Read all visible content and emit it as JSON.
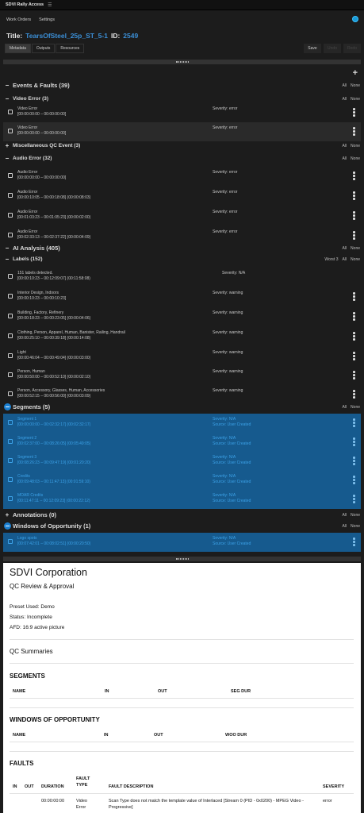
{
  "app": {
    "title": "SDVI Rally Access",
    "menu_icon": "menu-lines-icon"
  },
  "menu": {
    "items": [
      "Work Orders",
      "Settings"
    ]
  },
  "header": {
    "title_label": "Title:",
    "title_value": "TearsOfSteel_25p_ST_5-1",
    "id_label": "ID:",
    "id_value": "2549"
  },
  "tabs": [
    "Metadata",
    "Outputs",
    "Resources"
  ],
  "toolbar": {
    "save_label": "Save",
    "tool2": "Undo",
    "tool3": "Redo"
  },
  "controls": {
    "all": "All",
    "none": "None",
    "worst": "Worst 3"
  },
  "groups": {
    "events": {
      "sign": "−",
      "label": "Events & Faults (39)"
    },
    "video": {
      "sign": "−",
      "label": "Video Error (3)"
    },
    "misc": {
      "sign": "+",
      "label": "Miscellaneous QC Event (3)"
    },
    "audio": {
      "sign": "−",
      "label": "Audio Error (32)"
    },
    "ai": {
      "sign": "−",
      "label": "AI Analysis (405)"
    },
    "labels": {
      "sign": "−",
      "label": "Labels (152)"
    },
    "segments": {
      "sign": "−",
      "label": "Segments (5)"
    },
    "annotations": {
      "sign": "+",
      "label": "Annotations (0)"
    },
    "woo": {
      "sign": "−",
      "label": "Windows of Opportunity (1)"
    }
  },
  "video_items": [
    {
      "name": "Video Error",
      "tc": "[00:00:00:00 – 00:00:00:00]",
      "severity": "Severity: error"
    },
    {
      "name": "Video Error",
      "tc": "[00:00:00:00 – 00:00:00:00]",
      "severity": "Severity: error"
    }
  ],
  "audio_items": [
    {
      "name": "Audio Error",
      "tc": "[00:00:00:00 – 00:00:00:00]",
      "severity": "Severity: error"
    },
    {
      "name": "Audio Error",
      "tc": "[00:00:10:05 – 00:00:18:08]  (00:00:08:03)",
      "severity": "Severity: error"
    },
    {
      "name": "Audio Error",
      "tc": "[00:01:03:23 – 00:01:05:23]  (00:00:02:00)",
      "severity": "Severity: error"
    },
    {
      "name": "Audio Error",
      "tc": "[00:02:33:13 – 00:02:37:22]  (00:00:04:09)",
      "severity": "Severity: error"
    }
  ],
  "label_items": [
    {
      "name": "151 labels detected.",
      "tc": "[00:00:10:23 – 00:12:09:07]  (00:11:58:08)",
      "severity": "Severity: N/A",
      "menu": false
    },
    {
      "name": "Interior Design, Indoors",
      "tc": "[00:00:10:23 – 00:00:10:23]",
      "severity": "Severity: warning",
      "menu": true
    },
    {
      "name": "Building, Factory, Refinery",
      "tc": "[00:00:18:23 – 00:00:23:05]  (00:00:04:06)",
      "severity": "Severity: warning",
      "menu": true
    },
    {
      "name": "Clothing, Person, Apparel, Human, Banister, Railing, Handrail",
      "tc": "[00:00:25:10 – 00:00:39:18]  (00:00:14:08)",
      "severity": "Severity: warning",
      "menu": true
    },
    {
      "name": "Light",
      "tc": "[00:00:46:04 – 00:00:49:04]  (00:00:03:00)",
      "severity": "Severity: warning",
      "menu": true
    },
    {
      "name": "Person, Human",
      "tc": "[00:00:50:00 – 00:00:52:10]  (00:00:02:10)",
      "severity": "Severity: warning",
      "menu": true
    },
    {
      "name": "Person, Accessory, Glasses, Human, Accessories",
      "tc": "[00:00:52:15 – 00:00:56:00]  (00:00:03:09)",
      "severity": "Severity: warning",
      "menu": true
    }
  ],
  "segment_items": [
    {
      "name": "Segment 1",
      "tc": "[00:00:00:00 – 00:02:32:17]  (00:02:32:17)",
      "severity": "Severity: N/A",
      "source": "Source: User Created"
    },
    {
      "name": "Segment 2",
      "tc": "[00:02:37:00 – 00:08:26:05]  (00:05:49:05)",
      "severity": "Severity: N/A",
      "source": "Source: User Created"
    },
    {
      "name": "Segment 3",
      "tc": "[00:08:26:23 – 00:09:47:19]  (00:01:20:20)",
      "severity": "Severity: N/A",
      "source": "Source: User Created"
    },
    {
      "name": "Credits",
      "tc": "[00:09:48:03 – 00:11:47:13]  (00:01:59:10)",
      "severity": "Severity: N/A",
      "source": "Source: User Created"
    },
    {
      "name": "MOAR Credits",
      "tc": "[00:11:47:11 – 00:12:09:23]  (00:00:22:12)",
      "severity": "Severity: N/A",
      "source": "Source: User Created"
    }
  ],
  "woo_items": [
    {
      "name": "Logo spots",
      "tc": "[00:07:42:01 – 00:08:02:51]  (00:00:20:50)",
      "severity": "Severity: N/A",
      "source": "Source: User Created"
    }
  ],
  "report": {
    "company": "SDVI Corporation",
    "subtitle": "QC Review & Approval",
    "preset": "Preset Used: Demo",
    "status": "Status: Incomplete",
    "afd": "AFD: 16:9 active picture",
    "summaries": "QC Summaries",
    "segments_h": "SEGMENTS",
    "segments_cols": [
      "NAME",
      "IN",
      "OUT",
      "SEG DUR"
    ],
    "woo_h": "WINDOWS OF OPPORTUNITY",
    "woo_cols": [
      "NAME",
      "IN",
      "OUT",
      "WOO DUR"
    ],
    "faults_h": "FAULTS",
    "faults_cols": [
      "IN",
      "OUT",
      "DURATION",
      "FAULT TYPE",
      "FAULT DESCRIPTION",
      "SEVERITY"
    ],
    "fault_row": {
      "duration": "00:00:00:00",
      "type": "Video Error",
      "description": "Scan Type does not match the template value of Interlaced [Stream 0 (PID - 0x0200) - MPEG Video - Progressive]",
      "severity": "error"
    }
  }
}
